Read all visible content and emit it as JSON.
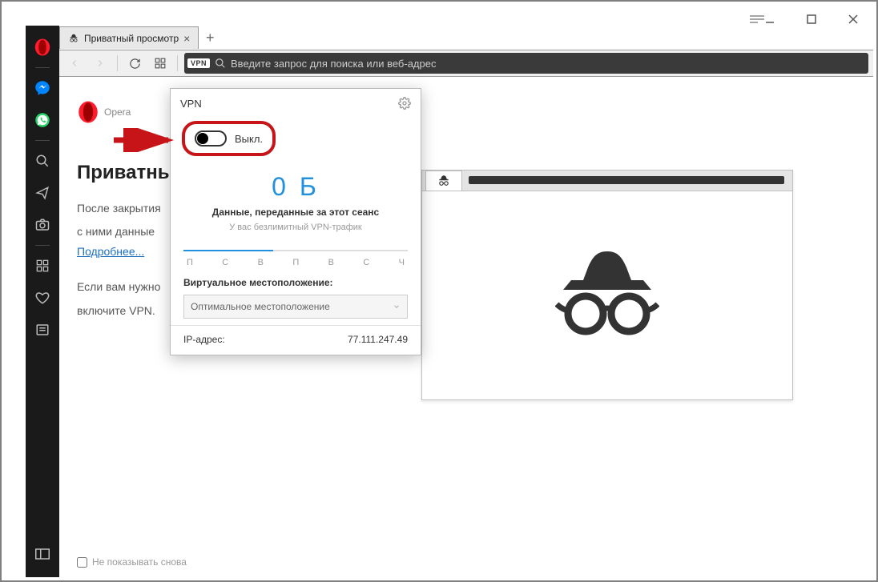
{
  "tab": {
    "title": "Приватный просмотр"
  },
  "address": {
    "placeholder": "Введите запрос для поиска или веб-адрес",
    "vpn_badge": "VPN"
  },
  "page": {
    "brand": "Opera",
    "headline": "Приватный просмотр",
    "para1": "После закрытия",
    "para2": "с ними данные",
    "learn_more": "Подробнее...",
    "para3": "Если вам нужно",
    "para4": "включите VPN.",
    "dont_show": "Не показывать снова"
  },
  "vpn": {
    "title": "VPN",
    "toggle_label": "Выкл.",
    "bytes": "0 Б",
    "session_label": "Данные, переданные за этот сеанс",
    "unlimited": "У вас безлимитный VPN-трафик",
    "days": [
      "П",
      "С",
      "В",
      "П",
      "В",
      "С",
      "Ч"
    ],
    "location_label": "Виртуальное местоположение:",
    "location_value": "Оптимальное местоположение",
    "ip_label": "IP-адрес:",
    "ip_value": "77.111.247.49"
  },
  "chart_data": {
    "type": "bar",
    "categories": [
      "П",
      "С",
      "В",
      "П",
      "В",
      "С",
      "Ч"
    ],
    "values": [
      0,
      0,
      0,
      0,
      0,
      0,
      0
    ],
    "title": "Данные, переданные за этот сеанс",
    "xlabel": "",
    "ylabel": "",
    "ylim": [
      0,
      1
    ]
  }
}
